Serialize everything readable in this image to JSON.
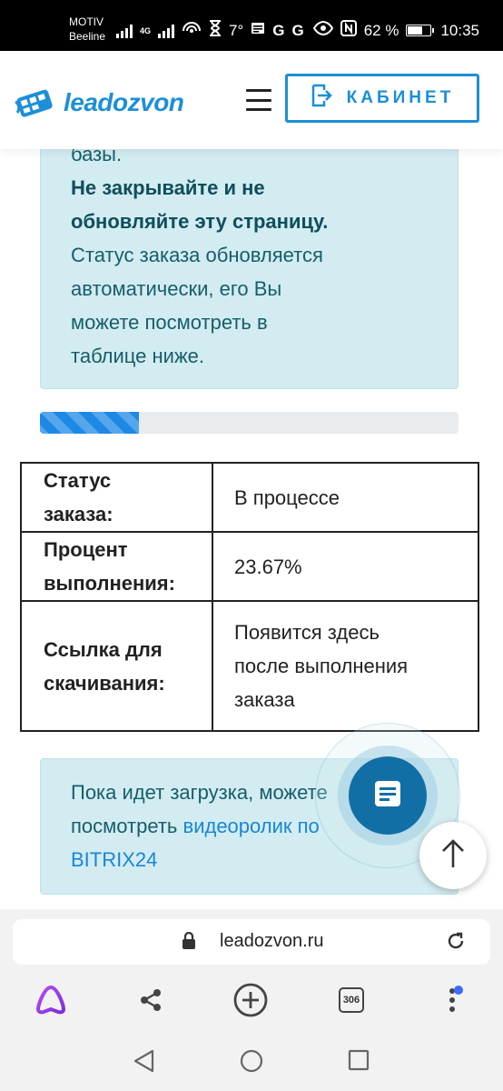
{
  "status_bar": {
    "carrier_line1": "MOTIV",
    "carrier_line2": "Beeline",
    "network_badge": "4G",
    "temperature": "7°",
    "battery_percent": "62 %",
    "time": "10:35"
  },
  "header": {
    "logo_text": "leadozvon",
    "cabinet_label": "КАБИНЕТ"
  },
  "info_box": {
    "line_clipped": "базы.",
    "bold_line1": "Не закрывайте и не",
    "bold_line2": "обновляйте эту страницу.",
    "line1": "Статус заказа обновляется",
    "line2": "автоматически, его Вы",
    "line3": "можете посмотреть в",
    "line4": "таблице ниже."
  },
  "progress": {
    "percent": 23.67
  },
  "order_table": {
    "rows": [
      {
        "key_line1": "Статус",
        "key_line2": "заказа:",
        "value_lines": [
          "В процессе"
        ]
      },
      {
        "key_line1": "Процент",
        "key_line2": "выполнения:",
        "value_lines": [
          "23.67%"
        ]
      },
      {
        "key_line1": "Ссылка для",
        "key_line2": "скачивания:",
        "value_lines": [
          "Появится здесь",
          "после выполнения",
          "заказа"
        ]
      }
    ]
  },
  "notice": {
    "line1": "Пока идет загрузка, можете",
    "line2_prefix": "посмотреть ",
    "link_text1": "видеоролик по",
    "link_text2": "BITRIX24"
  },
  "browser": {
    "url": "leadozvon.ru",
    "tabs_count": "306"
  },
  "colors": {
    "accent": "#1a8fd8",
    "info_bg": "#d2ecf1",
    "info_text": "#175d6b",
    "fab": "#126fa6",
    "progress": "#1e88e5"
  },
  "icons": [
    "signal-icon",
    "hotspot-icon",
    "hourglass-icon",
    "news-icon",
    "google-icon",
    "eye-icon",
    "nfc-icon",
    "battery-icon",
    "menu-icon",
    "login-icon",
    "chat-icon",
    "arrow-up-icon",
    "lock-icon",
    "reload-icon",
    "alice-icon",
    "share-icon",
    "plus-icon",
    "tabs-icon",
    "more-icon",
    "back-icon",
    "home-icon",
    "recents-icon"
  ]
}
